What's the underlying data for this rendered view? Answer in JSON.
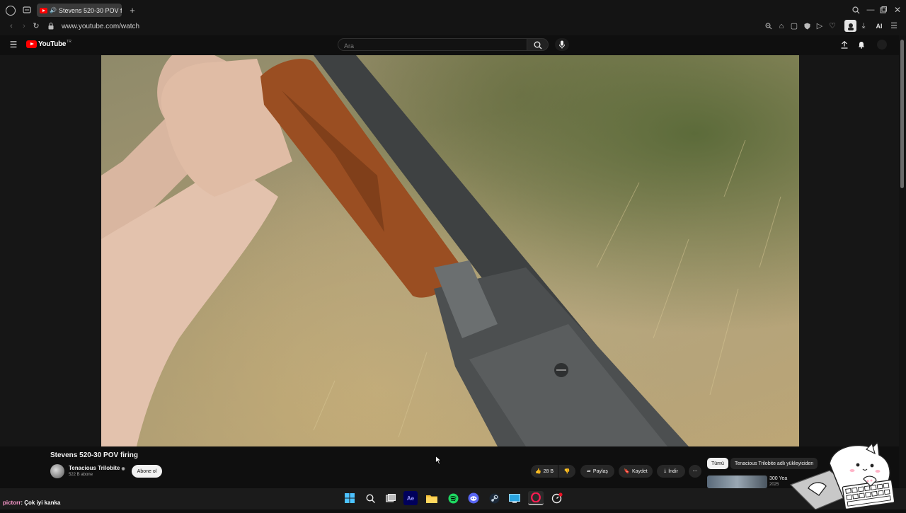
{
  "browser": {
    "tab_title": "Stevens 520-30 POV f",
    "url": "www.youtube.com/watch",
    "ai_label": "AI"
  },
  "youtube": {
    "wordmark": "YouTube",
    "region": "TR",
    "search_placeholder": "Ara"
  },
  "video": {
    "title": "Stevens 520-30 POV firing",
    "channel": "Tenacious Trilobite",
    "subscribers": "522 B abone",
    "subscribe_label": "Abone ol",
    "likes": "28 B",
    "share_label": "Paylaş",
    "save_label": "Kaydet",
    "download_label": "İndir"
  },
  "recommendations": {
    "chips": [
      "Tümü",
      "Tenacious Trilobite adlı yükleyiciden"
    ],
    "first_item_text": "300 Yea",
    "first_item_sub": "2025"
  },
  "overlay": {
    "chat_user": "pictorr",
    "chat_message": ": Çok iyi kanka"
  },
  "icons": {
    "browser_logo": "opera-icon",
    "search": "search-icon",
    "mic": "mic-icon",
    "upload": "upload-icon",
    "bell": "bell-icon"
  }
}
